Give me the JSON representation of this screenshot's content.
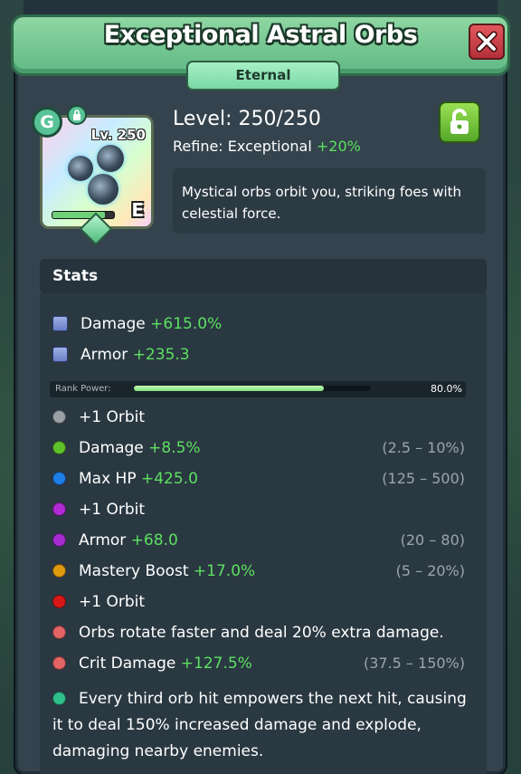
{
  "header": {
    "title": "Exceptional Astral Orbs",
    "rarity": "Eternal"
  },
  "colors": {
    "header_green": "#7acb95",
    "value_green": "#5ce060",
    "close_red": "#c93b43"
  },
  "icons": {
    "close": "close-x-icon",
    "lock": "padlock-icon",
    "gear_badge": "g-badge-icon"
  },
  "item": {
    "level_badge": "Lv. 250",
    "tier_letter": "E",
    "level_progress": 0.85
  },
  "info": {
    "level_text": "Level: 250/250",
    "refine_label": "Refine: Exceptional",
    "refine_bonus": "+20%",
    "description": "Mystical orbs orbit you, striking foes with celestial force."
  },
  "stats": {
    "heading": "Stats",
    "base": [
      {
        "name": "Damage",
        "value": "+615.0%"
      },
      {
        "name": "Armor",
        "value": "+235.3"
      }
    ],
    "rank": {
      "label": "Rank Power:",
      "value_text": "80.0%",
      "fraction": 0.8
    },
    "rolls": [
      {
        "name": "+1 Orbit",
        "value": "",
        "range": "",
        "color": "#9aa0a6"
      },
      {
        "name": "Damage",
        "value": "+8.5%",
        "range": "(2.5 – 10%)",
        "color": "#5fc22a"
      },
      {
        "name": "Max HP",
        "value": "+425.0",
        "range": "(125 – 500)",
        "color": "#1e7fe8"
      },
      {
        "name": "+1 Orbit",
        "value": "",
        "range": "",
        "color": "#b02bd4"
      },
      {
        "name": "Armor",
        "value": "+68.0",
        "range": "(20 – 80)",
        "color": "#a62bd0"
      },
      {
        "name": "Mastery Boost",
        "value": "+17.0%",
        "range": "(5 – 20%)",
        "color": "#e09a10"
      },
      {
        "name": "+1 Orbit",
        "value": "",
        "range": "",
        "color": "#d81818"
      },
      {
        "name": "Orbs rotate faster and deal 20% extra damage.",
        "value": "",
        "range": "",
        "color": "#e36464"
      },
      {
        "name": "Crit Damage",
        "value": "+127.5%",
        "range": "(37.5 – 150%)",
        "color": "#e36464"
      }
    ],
    "ability": {
      "text": "Every third orb hit empowers the next hit, causing it to deal 150% increased damage and explode, damaging nearby enemies.",
      "color": "#2fbf8c"
    }
  }
}
